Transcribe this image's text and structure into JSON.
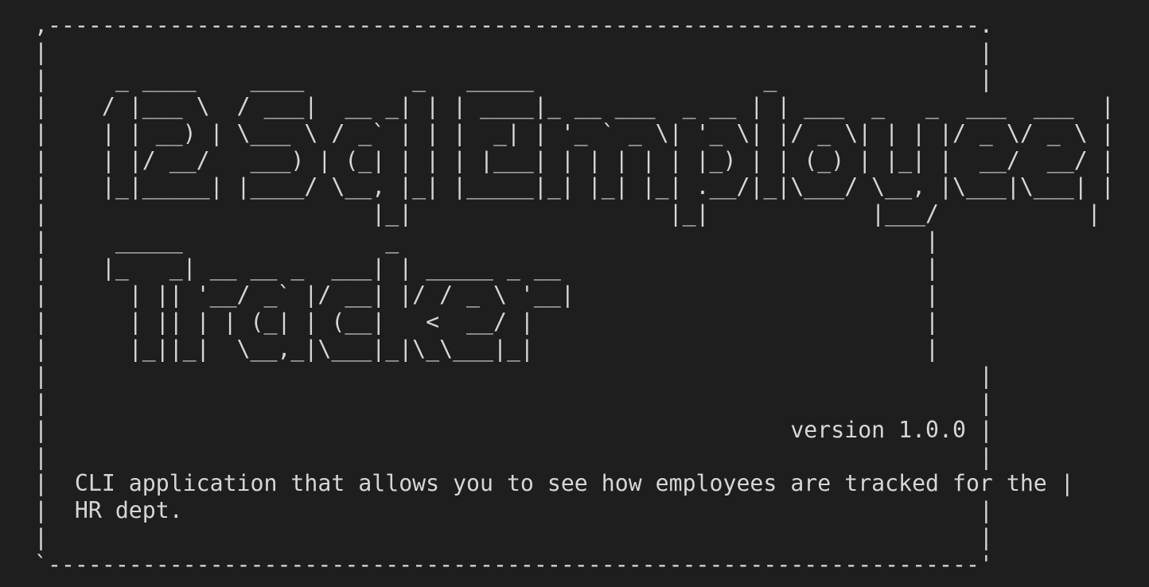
{
  "terminal": {
    "lines": [
      ",---------------------------------------------------------------------.",
      "|                                                                     |",
      "|     _ ____    ____        _   _____                 _               |",
      "|    / |___ \\  / ___|  __ _| | | ____|_ __ ___  _ __ | | ___  _   _  ___  ___  |",
      "|    | | __) | \\___ \\ / _` | | |  _| | '_ ` _ \\| '_ \\| |/ _ \\| | | |/ _ \\/ _ \\ |",
      "|    | |/ __/   ___) | (_| | | | |___| | | | | | |_) | | (_) | |_| |  __/  __/ |",
      "|    |_|_____| |____/ \\__, |_| |_____|_| |_| |_| .__/|_|\\___/ \\__, |\\___|\\___| |",
      "|                        |_|                   |_|            |___/           |",
      "|     _____               _                                       |",
      "|    |_   _| __ __ _  ___| | _____ _ __                           |",
      "|      | || '__/ _` |/ __| |/ / _ \\ '__|                          |",
      "|      | || | | (_| | (__|   <  __/ |                             |",
      "|      |_||_|  \\__,_|\\___|_|\\_\\___|_|                             |",
      "|                                                                     |",
      "|                                                                     |",
      "|                                                       version 1.0.0 |",
      "|                                                                     |",
      "|  CLI application that allows you to see how employees are tracked for the |",
      "|  HR dept.                                                           |",
      "|                                                                     |",
      "`---------------------------------------------------------------------'"
    ]
  }
}
